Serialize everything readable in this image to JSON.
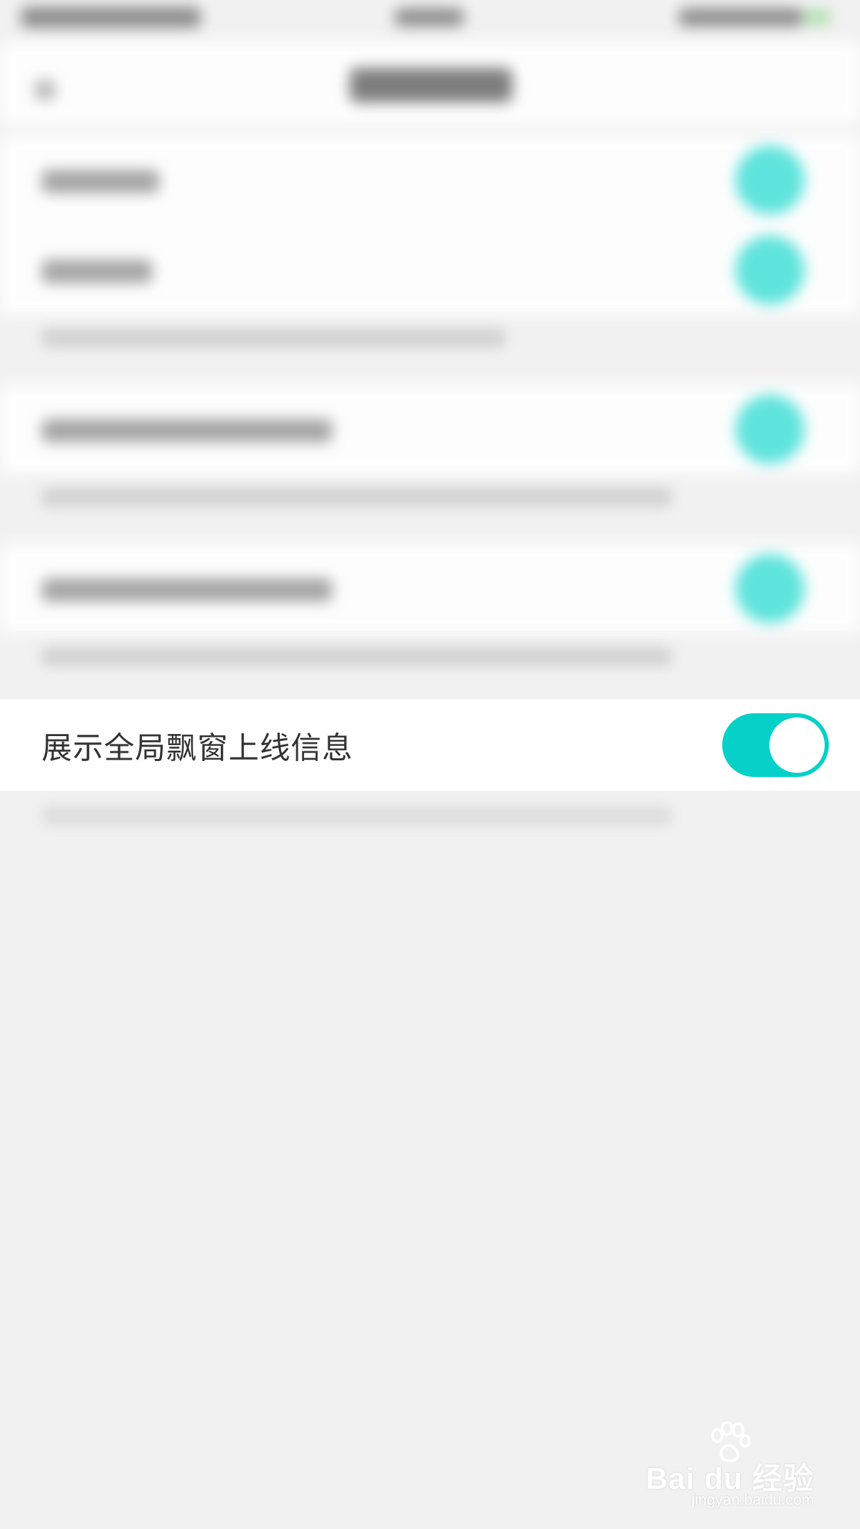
{
  "setting": {
    "label": "展示全局飘窗上线信息",
    "enabled": true,
    "accent_color": "#05d1c8"
  },
  "watermark": {
    "brand": "Bai du 经验",
    "url": "jingyan.baidu.com"
  },
  "icons": {
    "toggle": "switch-on-icon",
    "watermark_logo": "baidu-paw-icon"
  },
  "colors": {
    "background": "#f1f1f1",
    "row_background": "#ffffff",
    "text": "#333333"
  }
}
